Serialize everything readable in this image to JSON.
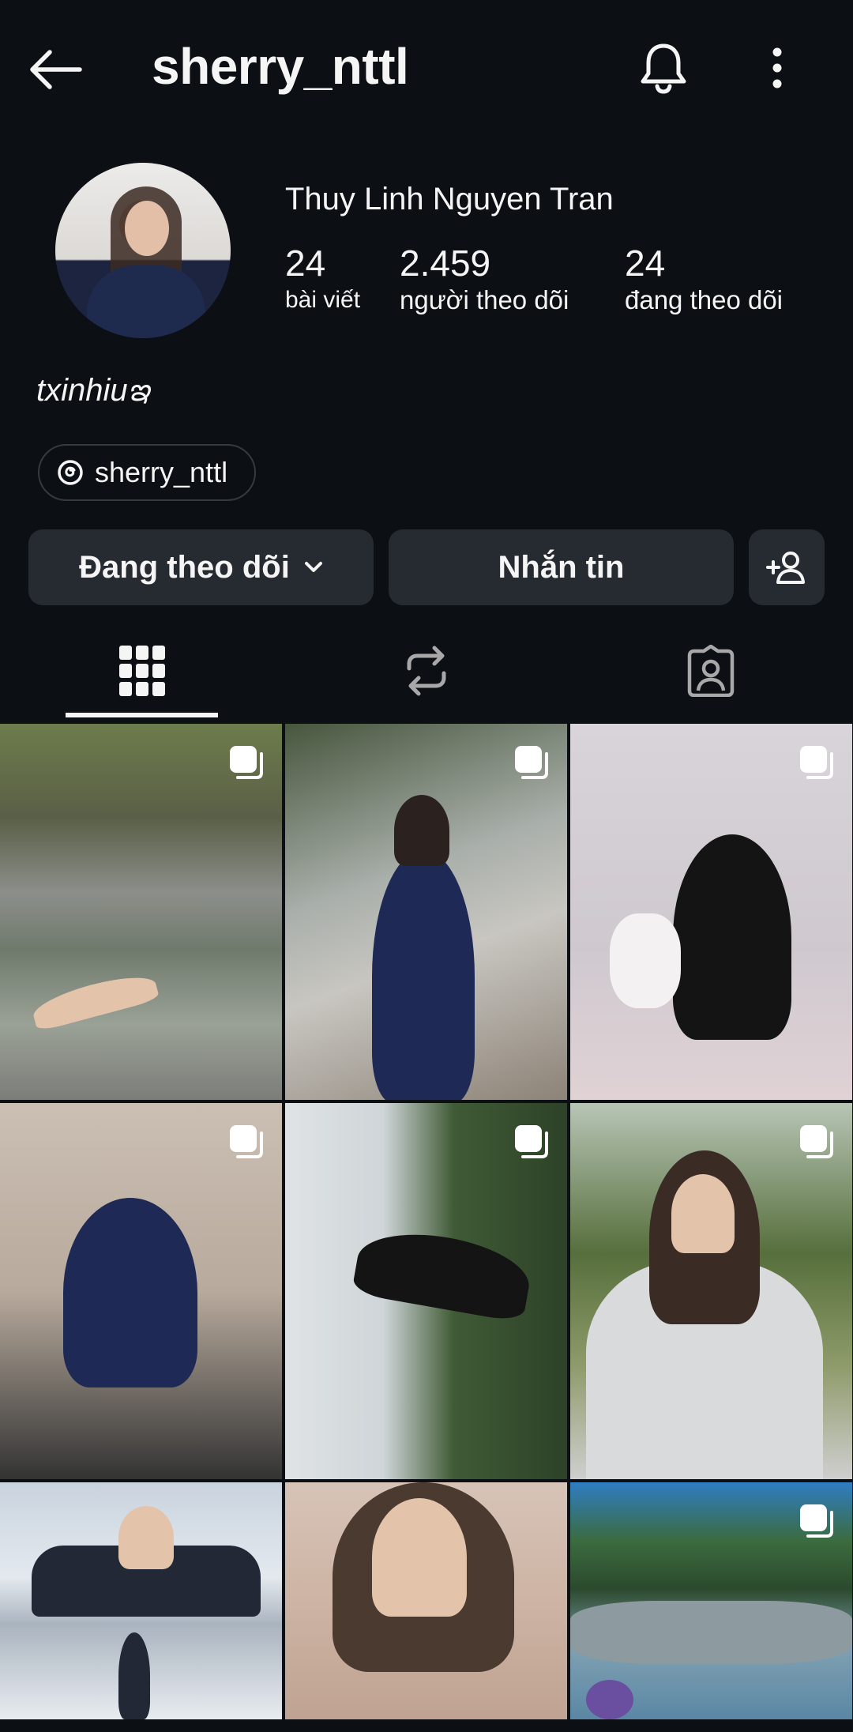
{
  "header": {
    "username": "sherry_nttl"
  },
  "profile": {
    "full_name": "Thuy Linh Nguyen Tran",
    "stats": [
      {
        "value": "24",
        "label": "bài viết"
      },
      {
        "value": "2.459",
        "label": "người theo dõi"
      },
      {
        "value": "24",
        "label": "đang theo dõi"
      }
    ],
    "bio": "txinhiuఇ",
    "threads_handle": "sherry_nttl"
  },
  "actions": {
    "follow_label": "Đang theo dõi",
    "message_label": "Nhắn tin"
  },
  "tabs": [
    {
      "icon": "grid-icon",
      "active": true
    },
    {
      "icon": "reels-repost-icon",
      "active": false
    },
    {
      "icon": "tagged-icon",
      "active": false
    }
  ],
  "posts_visible": 9,
  "colors": {
    "background": "#0c1014",
    "button_bg": "#262b31",
    "text": "#f5f5f5"
  }
}
